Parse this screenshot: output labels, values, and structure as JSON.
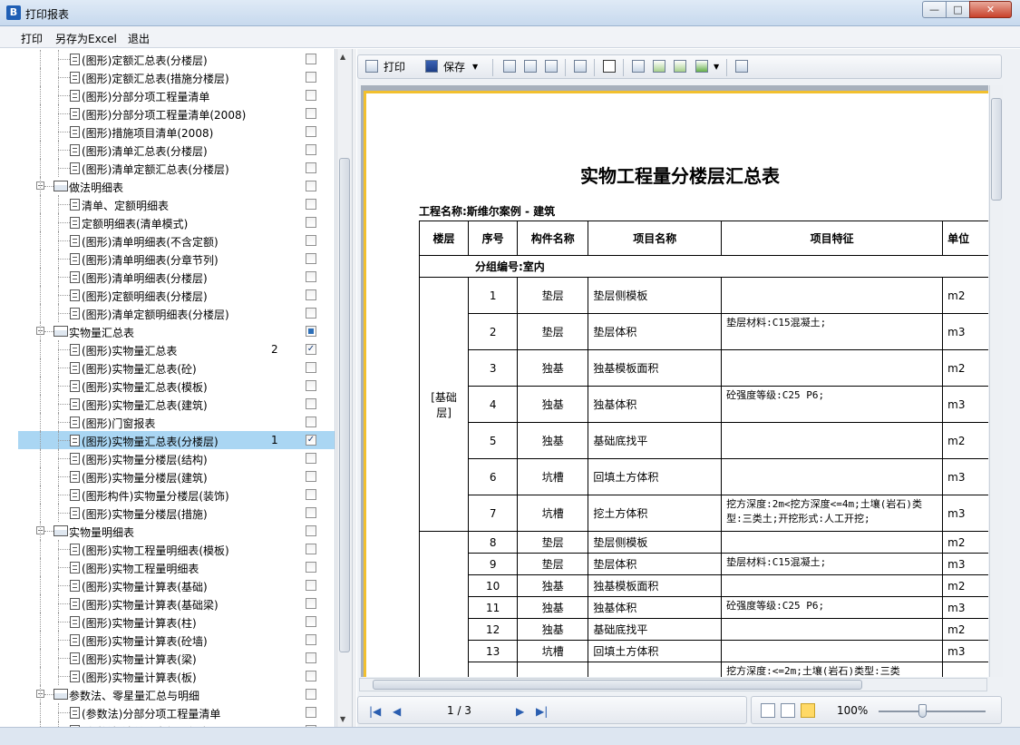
{
  "window": {
    "title": "打印报表"
  },
  "menu": [
    "打印",
    "另存为Excel",
    "退出"
  ],
  "tree": [
    {
      "type": "doc",
      "label": "(图形)定额汇总表(分楼层)",
      "level": 2,
      "checked": false
    },
    {
      "type": "doc",
      "label": "(图形)定额汇总表(措施分楼层)",
      "level": 2,
      "checked": false
    },
    {
      "type": "doc",
      "label": "(图形)分部分项工程量清单",
      "level": 2,
      "checked": false
    },
    {
      "type": "doc",
      "label": "(图形)分部分项工程量清单(2008)",
      "level": 2,
      "checked": false
    },
    {
      "type": "doc",
      "label": "(图形)措施项目清单(2008)",
      "level": 2,
      "checked": false
    },
    {
      "type": "doc",
      "label": "(图形)清单汇总表(分楼层)",
      "level": 2,
      "checked": false
    },
    {
      "type": "doc",
      "label": "(图形)清单定额汇总表(分楼层)",
      "level": 2,
      "checked": false
    },
    {
      "type": "group",
      "label": "做法明细表",
      "level": 1,
      "checked": false
    },
    {
      "type": "doc",
      "label": "清单、定额明细表",
      "level": 2,
      "checked": false
    },
    {
      "type": "doc",
      "label": "定额明细表(清单模式)",
      "level": 2,
      "checked": false
    },
    {
      "type": "doc",
      "label": "(图形)清单明细表(不含定额)",
      "level": 2,
      "checked": false
    },
    {
      "type": "doc",
      "label": "(图形)清单明细表(分章节列)",
      "level": 2,
      "checked": false
    },
    {
      "type": "doc",
      "label": "(图形)清单明细表(分楼层)",
      "level": 2,
      "checked": false
    },
    {
      "type": "doc",
      "label": "(图形)定额明细表(分楼层)",
      "level": 2,
      "checked": false
    },
    {
      "type": "doc",
      "label": "(图形)清单定额明细表(分楼层)",
      "level": 2,
      "checked": false
    },
    {
      "type": "group",
      "label": "实物量汇总表",
      "level": 1,
      "checked": "partial"
    },
    {
      "type": "doc",
      "label": "(图形)实物量汇总表",
      "level": 2,
      "count": "2",
      "checked": true
    },
    {
      "type": "doc",
      "label": "(图形)实物量汇总表(砼)",
      "level": 2,
      "checked": false
    },
    {
      "type": "doc",
      "label": "(图形)实物量汇总表(模板)",
      "level": 2,
      "checked": false
    },
    {
      "type": "doc",
      "label": "(图形)实物量汇总表(建筑)",
      "level": 2,
      "checked": false
    },
    {
      "type": "doc",
      "label": "(图形)门窗报表",
      "level": 2,
      "checked": false
    },
    {
      "type": "doc",
      "label": "(图形)实物量汇总表(分楼层)",
      "level": 2,
      "count": "1",
      "checked": true,
      "selected": true
    },
    {
      "type": "doc",
      "label": "(图形)实物量分楼层(结构)",
      "level": 2,
      "checked": false
    },
    {
      "type": "doc",
      "label": "(图形)实物量分楼层(建筑)",
      "level": 2,
      "checked": false
    },
    {
      "type": "doc",
      "label": "(图形构件)实物量分楼层(装饰)",
      "level": 2,
      "checked": false
    },
    {
      "type": "doc",
      "label": "(图形)实物量分楼层(措施)",
      "level": 2,
      "checked": false
    },
    {
      "type": "group",
      "label": "实物量明细表",
      "level": 1,
      "checked": false
    },
    {
      "type": "doc",
      "label": "(图形)实物工程量明细表(模板)",
      "level": 2,
      "checked": false
    },
    {
      "type": "doc",
      "label": "(图形)实物工程量明细表",
      "level": 2,
      "checked": false
    },
    {
      "type": "doc",
      "label": "(图形)实物量计算表(基础)",
      "level": 2,
      "checked": false
    },
    {
      "type": "doc",
      "label": "(图形)实物量计算表(基础梁)",
      "level": 2,
      "checked": false
    },
    {
      "type": "doc",
      "label": "(图形)实物量计算表(柱)",
      "level": 2,
      "checked": false
    },
    {
      "type": "doc",
      "label": "(图形)实物量计算表(砼墙)",
      "level": 2,
      "checked": false
    },
    {
      "type": "doc",
      "label": "(图形)实物量计算表(梁)",
      "level": 2,
      "checked": false
    },
    {
      "type": "doc",
      "label": "(图形)实物量计算表(板)",
      "level": 2,
      "checked": false
    },
    {
      "type": "group",
      "label": "参数法、零星量汇总与明细",
      "level": 1,
      "checked": false
    },
    {
      "type": "doc",
      "label": "(参数法)分部分项工程量清单",
      "level": 2,
      "checked": false
    },
    {
      "type": "doc",
      "label": "(参数法)清单、定额明细表",
      "level": 2,
      "checked": false
    }
  ],
  "toolbar": {
    "print": "打印",
    "save": "保存"
  },
  "report": {
    "title": "实物工程量分楼层汇总表",
    "project": "工程名称:斯维尔案例 - 建筑",
    "headers": [
      "楼层",
      "序号",
      "构件名称",
      "项目名称",
      "项目特征",
      "单位"
    ],
    "group_label": "分组编号:室内",
    "floor_label": "[基础层]",
    "rows_a": [
      {
        "no": "1",
        "comp": "垫层",
        "name": "垫层侧模板",
        "feature": "",
        "unit": "m2"
      },
      {
        "no": "2",
        "comp": "垫层",
        "name": "垫层体积",
        "feature": "垫层材料:C15混凝土;",
        "unit": "m3"
      },
      {
        "no": "3",
        "comp": "独基",
        "name": "独基模板面积",
        "feature": "",
        "unit": "m2"
      },
      {
        "no": "4",
        "comp": "独基",
        "name": "独基体积",
        "feature": "砼强度等级:C25 P6;",
        "unit": "m3"
      },
      {
        "no": "5",
        "comp": "独基",
        "name": "基础底找平",
        "feature": "",
        "unit": "m2"
      },
      {
        "no": "6",
        "comp": "坑槽",
        "name": "回填土方体积",
        "feature": "",
        "unit": "m3"
      },
      {
        "no": "7",
        "comp": "坑槽",
        "name": "挖土方体积",
        "feature": "挖方深度:2m<挖方深度<=4m;土壤(岩石)类型:三类土;开挖形式:人工开挖;",
        "unit": "m3"
      }
    ],
    "rows_b": [
      {
        "no": "8",
        "comp": "垫层",
        "name": "垫层侧模板",
        "feature": "",
        "unit": "m2"
      },
      {
        "no": "9",
        "comp": "垫层",
        "name": "垫层体积",
        "feature": "垫层材料:C15混凝土;",
        "unit": "m3"
      },
      {
        "no": "10",
        "comp": "独基",
        "name": "独基模板面积",
        "feature": "",
        "unit": "m2"
      },
      {
        "no": "11",
        "comp": "独基",
        "name": "独基体积",
        "feature": "砼强度等级:C25 P6;",
        "unit": "m3"
      },
      {
        "no": "12",
        "comp": "独基",
        "name": "基础底找平",
        "feature": "",
        "unit": "m2"
      },
      {
        "no": "13",
        "comp": "坑槽",
        "name": "回填土方体积",
        "feature": "",
        "unit": "m3"
      },
      {
        "no": "",
        "comp": "",
        "name": "",
        "feature": "挖方深度:<=2m;土壤(岩石)类型:三类",
        "unit": ""
      }
    ]
  },
  "status": {
    "page": "1 / 3",
    "zoom": "100%"
  }
}
